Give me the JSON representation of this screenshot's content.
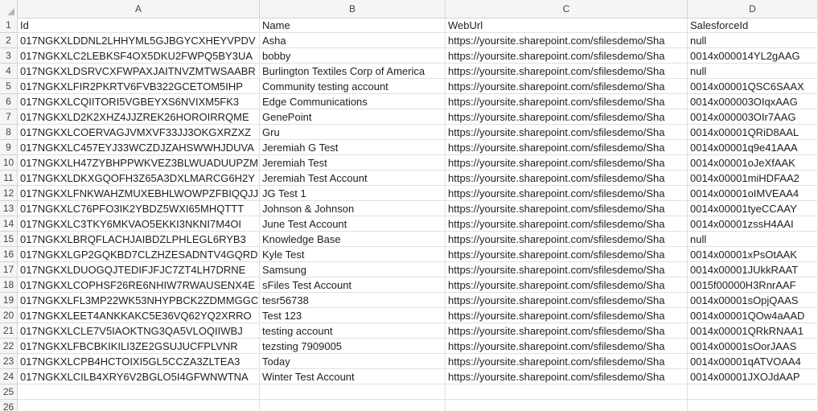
{
  "columns": [
    "A",
    "B",
    "C",
    "D"
  ],
  "rows": [
    {
      "n": "1",
      "cells": [
        "Id",
        "Name",
        "WebUrl",
        "SalesforceId"
      ]
    },
    {
      "n": "2",
      "cells": [
        "017NGKXLDDNL2LHHYML5GJBGYCXHEYVPDV",
        "Asha",
        "https://yoursite.sharepoint.com/sfilesdemo/Sha",
        "null"
      ]
    },
    {
      "n": "3",
      "cells": [
        "017NGKXLC2LEBKSF4OX5DKU2FWPQ5BY3UA",
        "bobby",
        "https://yoursite.sharepoint.com/sfilesdemo/Sha",
        "0014x000014YL2gAAG"
      ]
    },
    {
      "n": "4",
      "cells": [
        "017NGKXLDSRVCXFWPAXJAITNVZMTWSAABR",
        "Burlington Textiles Corp of America",
        "https://yoursite.sharepoint.com/sfilesdemo/Sha",
        "null"
      ]
    },
    {
      "n": "5",
      "cells": [
        "017NGKXLFIR2PKRTV6FVB322GCETOM5IHP",
        "Community testing account",
        "https://yoursite.sharepoint.com/sfilesdemo/Sha",
        "0014x00001QSC6SAAX"
      ]
    },
    {
      "n": "6",
      "cells": [
        "017NGKXLCQIITORI5VGBEYXS6NVIXM5FK3",
        "Edge Communications",
        "https://yoursite.sharepoint.com/sfilesdemo/Sha",
        "0014x000003OIqxAAG"
      ]
    },
    {
      "n": "7",
      "cells": [
        "017NGKXLD2K2XHZ4JJZREK26HOROIRRQME",
        "GenePoint",
        "https://yoursite.sharepoint.com/sfilesdemo/Sha",
        "0014x000003OIr7AAG"
      ]
    },
    {
      "n": "8",
      "cells": [
        "017NGKXLCOERVAGJVMXVF33JJ3OKGXRZXZ",
        "Gru",
        "https://yoursite.sharepoint.com/sfilesdemo/Sha",
        "0014x00001QRiD8AAL"
      ]
    },
    {
      "n": "9",
      "cells": [
        "017NGKXLC457EYJ33WCZDJZAHSWWHJDUVA",
        "Jeremiah G Test",
        "https://yoursite.sharepoint.com/sfilesdemo/Sha",
        "0014x00001q9e41AAA"
      ]
    },
    {
      "n": "10",
      "cells": [
        "017NGKXLH47ZYBHPPWKVEZ3BLWUADUUPZM",
        "Jeremiah Test",
        "https://yoursite.sharepoint.com/sfilesdemo/Sha",
        "0014x00001oJeXfAAK"
      ]
    },
    {
      "n": "11",
      "cells": [
        "017NGKXLDKXGQOFH3Z65A3DXLMARCG6H2Y",
        "Jeremiah Test Account",
        "https://yoursite.sharepoint.com/sfilesdemo/Sha",
        "0014x00001miHDFAA2"
      ]
    },
    {
      "n": "12",
      "cells": [
        "017NGKXLFNKWAHZMUXEBHLWOWPZFBIQQJJ",
        "JG Test 1",
        "https://yoursite.sharepoint.com/sfilesdemo/Sha",
        "0014x00001oIMVEAA4"
      ]
    },
    {
      "n": "13",
      "cells": [
        "017NGKXLC76PFO3IK2YBDZ5WXI65MHQTTT",
        "Johnson & Johnson",
        "https://yoursite.sharepoint.com/sfilesdemo/Sha",
        "0014x00001tyeCCAAY"
      ]
    },
    {
      "n": "14",
      "cells": [
        "017NGKXLC3TKY6MKVAO5EKKI3NKNI7M4OI",
        "June Test Account",
        "https://yoursite.sharepoint.com/sfilesdemo/Sha",
        "0014x00001zssH4AAI"
      ]
    },
    {
      "n": "15",
      "cells": [
        "017NGKXLBRQFLACHJAIBDZLPHLEGL6RYB3",
        "Knowledge Base",
        "https://yoursite.sharepoint.com/sfilesdemo/Sha",
        "null"
      ]
    },
    {
      "n": "16",
      "cells": [
        "017NGKXLGP2GQKBD7CLZHZESADNTV4GQRD",
        "Kyle Test",
        "https://yoursite.sharepoint.com/sfilesdemo/Sha",
        "0014x00001xPsOtAAK"
      ]
    },
    {
      "n": "17",
      "cells": [
        "017NGKXLDUOGQJTEDIFJFJC7ZT4LH7DRNE",
        "Samsung",
        "https://yoursite.sharepoint.com/sfilesdemo/Sha",
        "0014x00001JUkkRAAT"
      ]
    },
    {
      "n": "18",
      "cells": [
        "017NGKXLCOPHSF26RE6NHIW7RWAUSENX4E",
        "sFiles Test Account",
        "https://yoursite.sharepoint.com/sfilesdemo/Sha",
        "0015f00000H3RnrAAF"
      ]
    },
    {
      "n": "19",
      "cells": [
        "017NGKXLFL3MP22WK53NHYPBCK2ZDMMGGC",
        "tesr56738",
        "https://yoursite.sharepoint.com/sfilesdemo/Sha",
        "0014x00001sOpjQAAS"
      ]
    },
    {
      "n": "20",
      "cells": [
        "017NGKXLEET4ANKKAKC5E36VQ62YQ2XRRO",
        "Test 123",
        "https://yoursite.sharepoint.com/sfilesdemo/Sha",
        "0014x00001QOw4aAAD"
      ]
    },
    {
      "n": "21",
      "cells": [
        "017NGKXLCLE7V5IAOKTNG3QA5VLOQIIWBJ",
        "testing account",
        "https://yoursite.sharepoint.com/sfilesdemo/Sha",
        "0014x00001QRkRNAA1"
      ]
    },
    {
      "n": "22",
      "cells": [
        "017NGKXLFBCBKIKILI3ZE2GSUJUCFPLVNR",
        "tezsting 7909005",
        "https://yoursite.sharepoint.com/sfilesdemo/Sha",
        "0014x00001sOorJAAS"
      ]
    },
    {
      "n": "23",
      "cells": [
        "017NGKXLCPB4HCTOIXI5GL5CCZA3ZLTEA3",
        "Today",
        "https://yoursite.sharepoint.com/sfilesdemo/Sha",
        "0014x00001qATVOAA4"
      ]
    },
    {
      "n": "24",
      "cells": [
        "017NGKXLCILB4XRY6V2BGLO5I4GFWNWTNA",
        "Winter Test Account",
        "https://yoursite.sharepoint.com/sfilesdemo/Sha",
        "0014x00001JXOJdAAP"
      ]
    },
    {
      "n": "25",
      "cells": [
        "",
        "",
        "",
        ""
      ]
    },
    {
      "n": "26",
      "cells": [
        "",
        "",
        "",
        ""
      ]
    }
  ]
}
